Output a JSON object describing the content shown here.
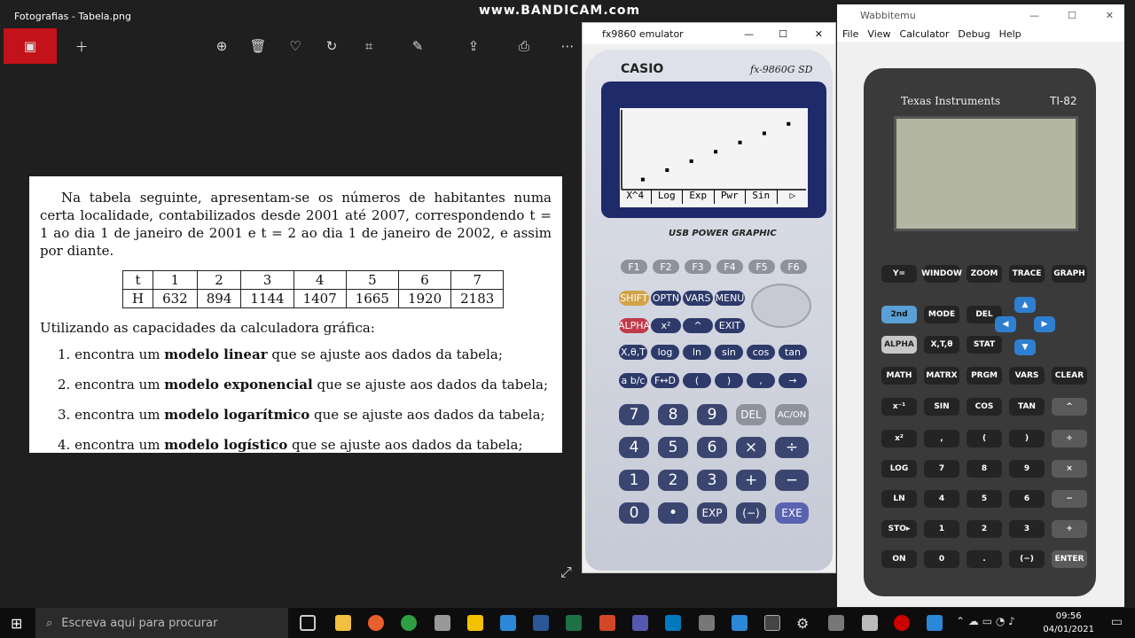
{
  "watermark": "www.BANDICAM.com",
  "photos": {
    "title": "Fotografias - Tabela.png",
    "document": {
      "intro": "Na tabela seguinte, apresentam-se os números de habitantes numa certa localidade, contabilizados desde 2001 até 2007, correspondendo t = 1 ao dia 1 de janeiro de 2001 e t = 2 ao dia 1 de janeiro de 2002, e assim por diante.",
      "table": {
        "row_t_label": "t",
        "row_h_label": "H",
        "t": [
          "1",
          "2",
          "3",
          "4",
          "5",
          "6",
          "7"
        ],
        "h": [
          "632",
          "894",
          "1144",
          "1407",
          "1665",
          "1920",
          "2183"
        ]
      },
      "question": "Utilizando as capacidades da calculadora gráfica:",
      "items": [
        {
          "num": "1.",
          "pre": "encontra um ",
          "bold": "modelo linear",
          "post": " que se ajuste aos dados da tabela;"
        },
        {
          "num": "2.",
          "pre": "encontra um ",
          "bold": "modelo exponencial",
          "post": " que se ajuste aos dados da tabela;"
        },
        {
          "num": "3.",
          "pre": "encontra um ",
          "bold": "modelo logarítmico",
          "post": " que se ajuste aos dados da tabela;"
        },
        {
          "num": "4.",
          "pre": "encontra um ",
          "bold": "modelo logístico",
          "post": " que se ajuste aos dados da tabela;"
        }
      ]
    }
  },
  "fx": {
    "title": "fx9860 emulator",
    "brand": "CASIO",
    "model": "fx-9860G SD",
    "subtitle": "USB POWER GRAPHIC",
    "menu": [
      "X^4",
      "Log",
      "Exp",
      "Pwr",
      "Sin",
      "▷"
    ],
    "keys": {
      "f": [
        "F1",
        "F2",
        "F3",
        "F4",
        "F5",
        "F6"
      ],
      "row1": [
        "SHIFT",
        "OPTN",
        "VARS",
        "MENU"
      ],
      "row2": [
        "ALPHA",
        "x²",
        "^",
        "EXIT"
      ],
      "row3": [
        "X,θ,T",
        "log",
        "ln",
        "sin",
        "cos",
        "tan"
      ],
      "row4": [
        "a b/c",
        "F↔D",
        "(",
        ")",
        ",",
        "→"
      ],
      "row5": [
        "7",
        "8",
        "9",
        "DEL",
        "AC/ON"
      ],
      "row6": [
        "4",
        "5",
        "6",
        "×",
        "÷"
      ],
      "row7": [
        "1",
        "2",
        "3",
        "+",
        "−"
      ],
      "row8": [
        "0",
        "•",
        "EXP",
        "(−)",
        "EXE"
      ]
    }
  },
  "wab": {
    "title": "Wabbitemu",
    "menu": [
      "File",
      "View",
      "Calculator",
      "Debug",
      "Help"
    ],
    "brand": "Texas Instruments",
    "model": "TI-82",
    "rows": [
      [
        "Y=",
        "WINDOW",
        "ZOOM",
        "TRACE",
        "GRAPH"
      ],
      [
        "2nd",
        "MODE",
        "DEL"
      ],
      [
        "ALPHA",
        "X,T,θ",
        "STAT"
      ],
      [
        "MATH",
        "MATRX",
        "PRGM",
        "VARS",
        "CLEAR"
      ],
      [
        "x⁻¹",
        "SIN",
        "COS",
        "TAN",
        "^"
      ],
      [
        "x²",
        ",",
        "(",
        ")",
        "÷"
      ],
      [
        "LOG",
        "7",
        "8",
        "9",
        "×"
      ],
      [
        "LN",
        "4",
        "5",
        "6",
        "−"
      ],
      [
        "STO▸",
        "1",
        "2",
        "3",
        "+"
      ],
      [
        "ON",
        "0",
        ".",
        "(−)",
        "ENTER"
      ]
    ]
  },
  "taskbar": {
    "search_placeholder": "Escreva aqui para procurar",
    "time": "09:56",
    "date": "04/01/2021"
  }
}
